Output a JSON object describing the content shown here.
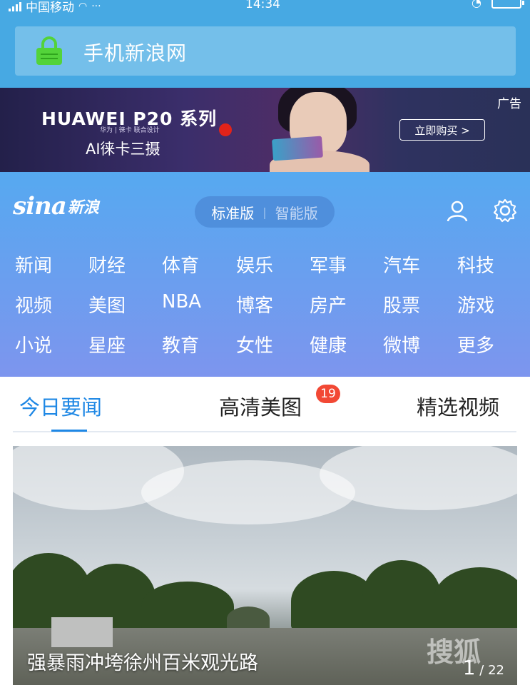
{
  "status_bar": {
    "carrier": "中国移动",
    "time": "14:34"
  },
  "url_bar": {
    "title": "手机新浪网"
  },
  "ad": {
    "brand": "HUAWEI P20 系列",
    "subline": "华为 | 徕卡 联合设计",
    "tagline": "AI徕卡三摄",
    "label": "广告",
    "cta": "立即购买 >"
  },
  "header": {
    "logo_en": "sina",
    "logo_cn": "新浪",
    "version_standard": "标准版",
    "version_smart": "智能版"
  },
  "nav": {
    "rows": [
      [
        "新闻",
        "财经",
        "体育",
        "娱乐",
        "军事",
        "汽车",
        "科技"
      ],
      [
        "视频",
        "美图",
        "NBA",
        "博客",
        "房产",
        "股票",
        "游戏"
      ],
      [
        "小说",
        "星座",
        "教育",
        "女性",
        "健康",
        "微博",
        "更多"
      ]
    ]
  },
  "tabs": {
    "items": [
      {
        "label": "今日要闻",
        "active": true
      },
      {
        "label": "高清美图",
        "badge": "19"
      },
      {
        "label": "精选视频"
      }
    ]
  },
  "news": {
    "caption": "强暴雨冲垮徐州百米观光路",
    "current": "1",
    "total": "/ 22",
    "watermark": "搜狐"
  },
  "colors": {
    "accent": "#1f88e5",
    "badge": "#f24834",
    "status_bg": "#47a9e3"
  }
}
